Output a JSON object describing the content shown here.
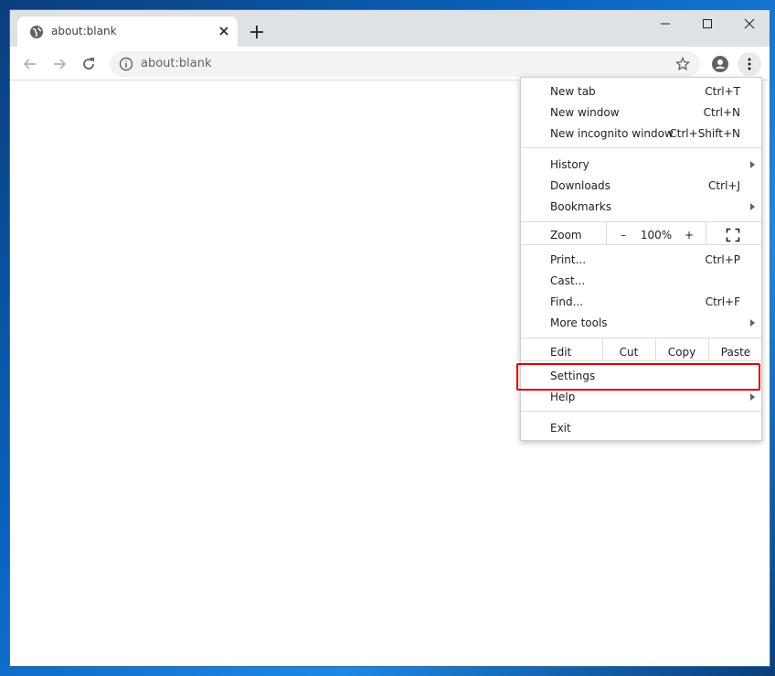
{
  "browser": {
    "tab": {
      "title": "about:blank",
      "favicon": "globe-icon"
    },
    "address_bar": {
      "url": "about:blank"
    }
  },
  "menu": {
    "new_tab": {
      "label": "New tab",
      "shortcut": "Ctrl+T"
    },
    "new_window": {
      "label": "New window",
      "shortcut": "Ctrl+N"
    },
    "new_incognito": {
      "label": "New incognito window",
      "shortcut": "Ctrl+Shift+N"
    },
    "history": {
      "label": "History"
    },
    "downloads": {
      "label": "Downloads",
      "shortcut": "Ctrl+J"
    },
    "bookmarks": {
      "label": "Bookmarks"
    },
    "zoom": {
      "label": "Zoom",
      "minus": "–",
      "value": "100%",
      "plus": "+"
    },
    "print": {
      "label": "Print...",
      "shortcut": "Ctrl+P"
    },
    "cast": {
      "label": "Cast..."
    },
    "find": {
      "label": "Find...",
      "shortcut": "Ctrl+F"
    },
    "more_tools": {
      "label": "More tools"
    },
    "edit": {
      "label": "Edit",
      "cut": "Cut",
      "copy": "Copy",
      "paste": "Paste"
    },
    "settings": {
      "label": "Settings"
    },
    "help": {
      "label": "Help"
    },
    "exit": {
      "label": "Exit"
    }
  },
  "colors": {
    "highlight": "#e00000",
    "titlebar": "#dee1e6"
  }
}
